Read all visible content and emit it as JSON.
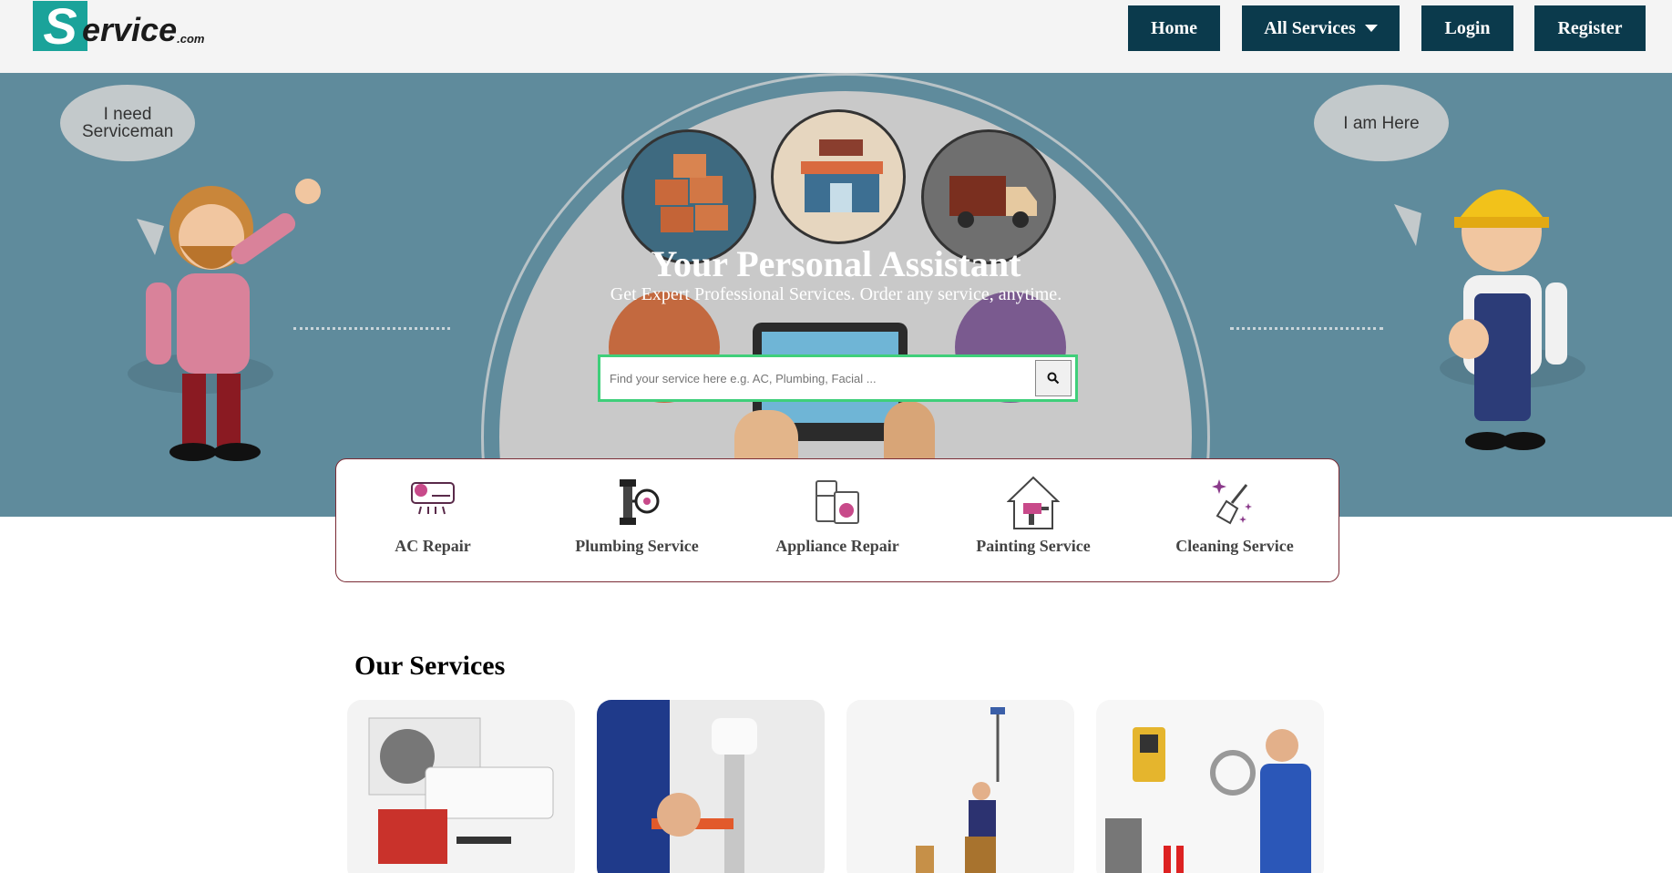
{
  "header": {
    "logo": {
      "letter": "S",
      "rest": "ervice",
      "suffix": ".com"
    },
    "nav": {
      "home": "Home",
      "all_services": "All Services",
      "login": "Login",
      "register": "Register"
    }
  },
  "hero": {
    "speech_left": "I need Serviceman",
    "speech_right": "I am Here",
    "title": "Your Personal Assistant",
    "subtitle": "Get Expert Professional Services. Order any service, anytime.",
    "search": {
      "placeholder": "Find your service here e.g. AC, Plumbing, Facial ..."
    }
  },
  "categories": [
    {
      "label": "AC Repair",
      "icon": "ac-unit-icon"
    },
    {
      "label": "Plumbing Service",
      "icon": "pipe-wrench-icon"
    },
    {
      "label": "Appliance Repair",
      "icon": "washing-machine-icon"
    },
    {
      "label": "Painting Service",
      "icon": "paint-house-icon"
    },
    {
      "label": "Cleaning Service",
      "icon": "broom-sparkle-icon"
    }
  ],
  "services": {
    "title": "Our Services",
    "cards": [
      {
        "image": "ac-tools-image"
      },
      {
        "image": "plumber-hands-image"
      },
      {
        "image": "painter-roller-image"
      },
      {
        "image": "electrician-tools-image"
      }
    ]
  },
  "colors": {
    "nav_bg": "#0b3a4c",
    "hero_bg": "#5f8b9c",
    "logo_accent": "#1aa39a",
    "search_border": "#3fcf7a",
    "category_border": "#7a2a34"
  }
}
